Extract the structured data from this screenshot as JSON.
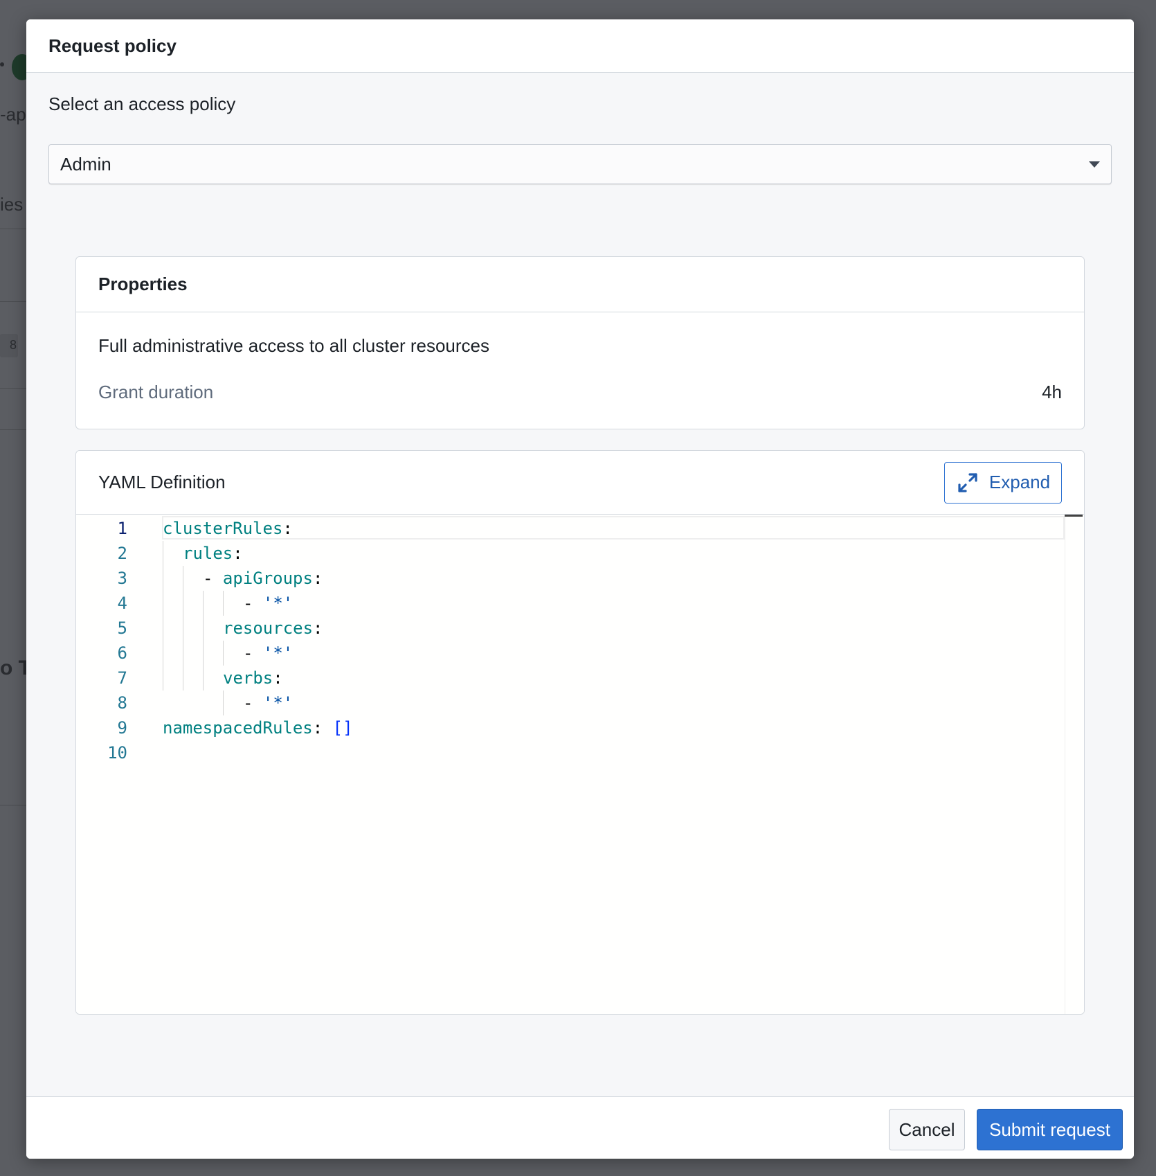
{
  "background": {
    "fragments": [
      "-app",
      "ies",
      "8",
      "o T"
    ]
  },
  "dialog": {
    "title": "Request policy",
    "policy_label": "Select an access policy",
    "policy_selected": "Admin"
  },
  "properties": {
    "title": "Properties",
    "description": "Full administrative access to all cluster resources",
    "grant_label": "Grant duration",
    "grant_value": "4h"
  },
  "yaml": {
    "title": "YAML Definition",
    "expand_label": "Expand",
    "line_numbers": [
      "1",
      "2",
      "3",
      "4",
      "5",
      "6",
      "7",
      "8",
      "9",
      "10"
    ],
    "lines": {
      "l1_key": "clusterRules",
      "colon": ":",
      "l2_key": "rules",
      "dash": "- ",
      "l3_key": "apiGroups",
      "star": "'*'",
      "l5_key": "resources",
      "l7_key": "verbs",
      "l9_key": "namespacedRules",
      "l9_val": "[]"
    }
  },
  "footer": {
    "cancel_label": "Cancel",
    "submit_label": "Submit request"
  },
  "colors": {
    "accent": "#2d72d2",
    "yaml_key": "#008080",
    "yaml_string": "#0451a5",
    "line_number": "#237893"
  }
}
